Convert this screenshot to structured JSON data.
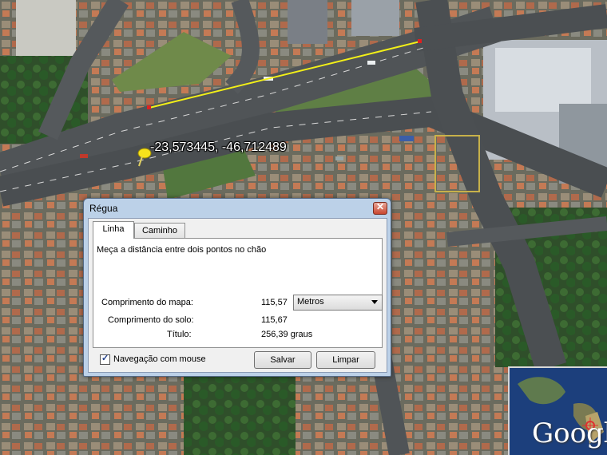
{
  "map": {
    "coordinates_label": "-23,573445, -46,712489",
    "overview_logo": "Google"
  },
  "dialog": {
    "title": "Régua",
    "tabs": [
      {
        "label": "Linha",
        "active": true
      },
      {
        "label": "Caminho",
        "active": false
      }
    ],
    "description": "Meça a distância entre dois pontos no chão",
    "map_length_label": "Comprimento do mapa:",
    "map_length_value": "115,57",
    "units_selected": "Metros",
    "ground_length_label": "Comprimento do solo:",
    "ground_length_value": "115,67",
    "heading_label": "Título:",
    "heading_value": "256,39 graus",
    "mouse_nav_label": "Navegação com mouse",
    "mouse_nav_checked": true,
    "save_label": "Salvar",
    "clear_label": "Limpar"
  }
}
